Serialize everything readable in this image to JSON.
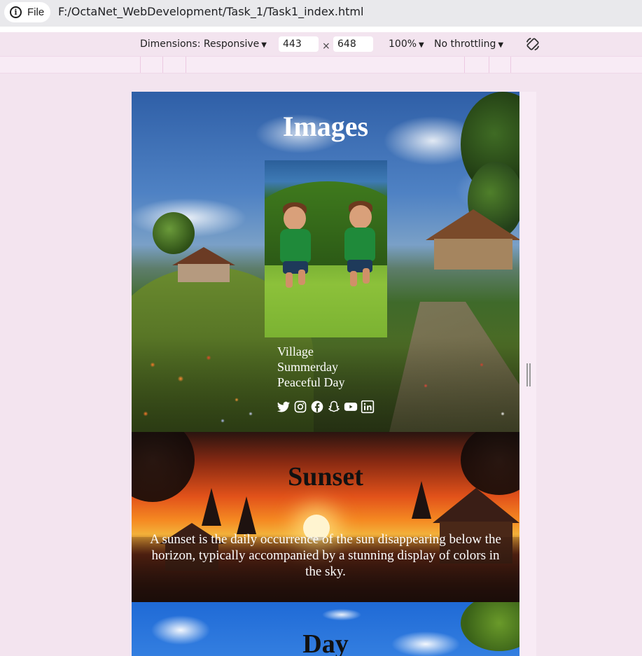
{
  "browser": {
    "file_chip_label": "File",
    "url": "F:/OctaNet_WebDevelopment/Task_1/Task1_index.html"
  },
  "devtools": {
    "dimensions_label": "Dimensions: Responsive",
    "width_value": "443",
    "height_value": "648",
    "times": "×",
    "zoom_label": "100%",
    "throttle_label": "No throttling"
  },
  "page": {
    "images_section": {
      "title": "Images",
      "lines": [
        "Village",
        "Summerday",
        "Peaceful Day"
      ],
      "social_icons": [
        "twitter-icon",
        "instagram-icon",
        "facebook-icon",
        "snapchat-icon",
        "youtube-icon",
        "linkedin-icon"
      ]
    },
    "sunset_section": {
      "title": "Sunset",
      "description": "A sunset is the daily occurrence of the sun disappearing below the horizon, typically accompanied by a stunning display of colors in the sky."
    },
    "day_section": {
      "title": "Day"
    }
  }
}
